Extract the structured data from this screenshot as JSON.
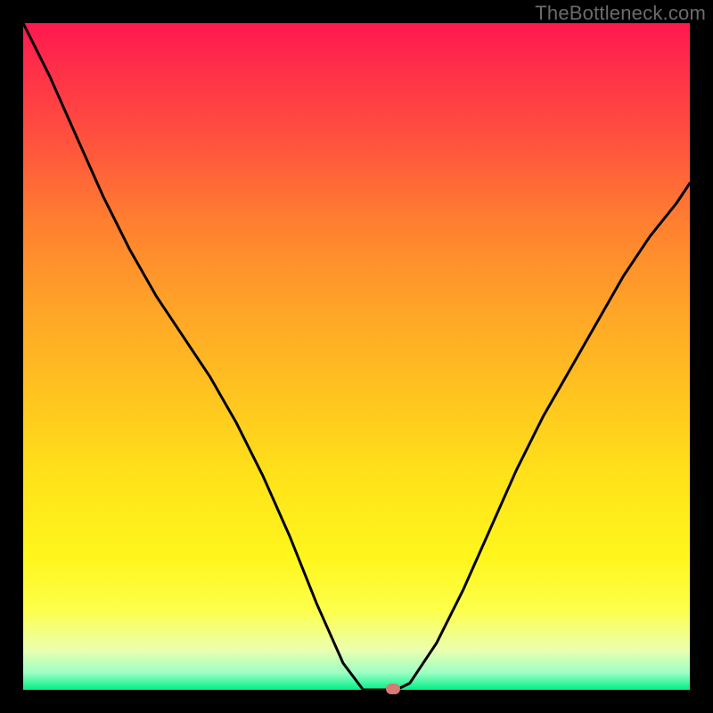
{
  "watermark": "TheBottleneck.com",
  "marker": {
    "x_frac": 0.555,
    "y_frac": 0.998
  },
  "chart_data": {
    "type": "line",
    "title": "",
    "xlabel": "",
    "ylabel": "",
    "xlim": [
      0,
      1
    ],
    "ylim": [
      0,
      1
    ],
    "series": [
      {
        "name": "curve",
        "x": [
          0.0,
          0.04,
          0.08,
          0.12,
          0.16,
          0.2,
          0.24,
          0.28,
          0.32,
          0.36,
          0.4,
          0.44,
          0.48,
          0.51,
          0.56,
          0.58,
          0.62,
          0.66,
          0.7,
          0.74,
          0.78,
          0.82,
          0.86,
          0.9,
          0.94,
          0.98,
          1.0
        ],
        "y": [
          1.0,
          0.92,
          0.83,
          0.74,
          0.66,
          0.59,
          0.53,
          0.47,
          0.4,
          0.32,
          0.23,
          0.13,
          0.04,
          0.0,
          0.0,
          0.01,
          0.07,
          0.15,
          0.24,
          0.33,
          0.41,
          0.48,
          0.55,
          0.62,
          0.68,
          0.73,
          0.76
        ]
      }
    ],
    "annotations": [
      {
        "type": "marker",
        "x": 0.555,
        "y": 0.0,
        "color": "#d47b72"
      }
    ]
  }
}
